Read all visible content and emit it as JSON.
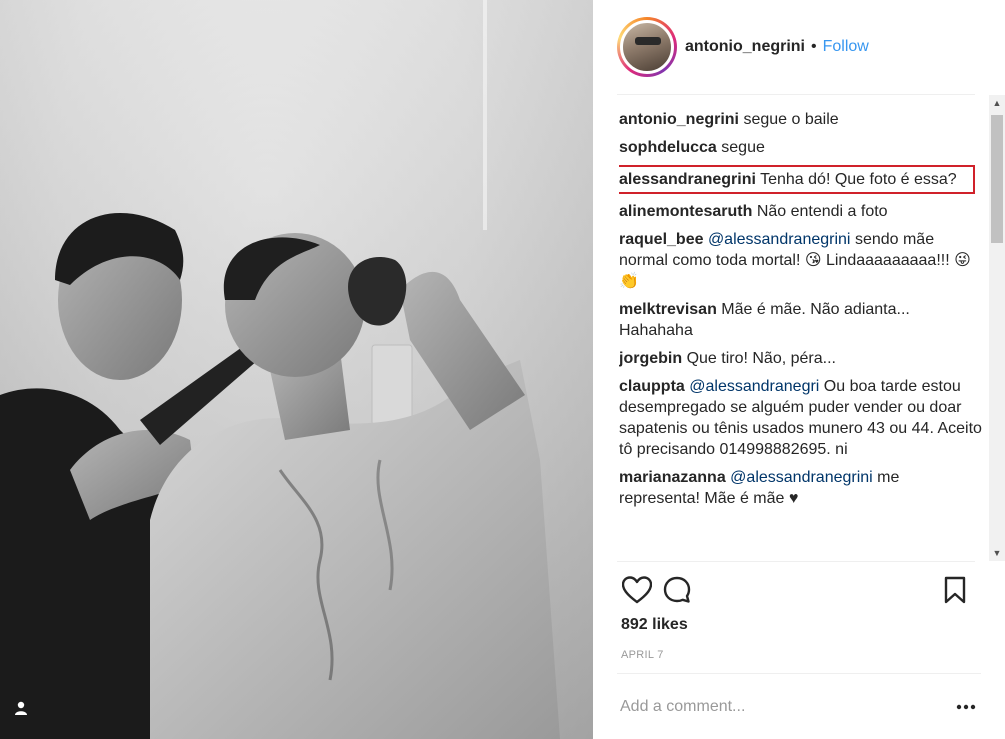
{
  "header": {
    "username": "antonio_negrini",
    "separator": "•",
    "follow_label": "Follow",
    "avatar_icon": "profile-avatar"
  },
  "comments": [
    {
      "user": "antonio_negrini",
      "mention": "",
      "text": "segue o baile"
    },
    {
      "user": "sophdelucca",
      "mention": "",
      "text": "segue"
    },
    {
      "user": "alessandranegrini",
      "mention": "",
      "text": "Tenha dó! Que foto é essa?",
      "highlighted": true
    },
    {
      "user": "alinemontesaruth",
      "mention": "",
      "text": "Não entendi a foto"
    },
    {
      "user": "raquel_bee",
      "mention": "@alessandranegrini",
      "text": "sendo mãe normal como toda mortal! 😘 Lindaaaaaaaaa!!! 😜👏"
    },
    {
      "user": "melktrevisan",
      "mention": "",
      "text": "Mãe é mãe. Não adianta... Hahahaha"
    },
    {
      "user": "jorgebin",
      "mention": "",
      "text": "Que tiro! Não, péra..."
    },
    {
      "user": "clauppta",
      "mention": "@alessandranegri",
      "text": "Ou boa tarde estou desempregado se alguém puder vender ou doar sapatenis ou tênis usados munero 43 ou 44. Aceito tô precisando 014998882695. ni"
    },
    {
      "user": "marianazanna",
      "mention": "@alessandranegrini",
      "text": "me representa! Mãe é mãe ♥"
    }
  ],
  "actions": {
    "like_icon": "heart-icon",
    "comment_icon": "comment-bubble-icon",
    "save_icon": "bookmark-icon"
  },
  "likes": "892 likes",
  "date": "APRIL 7",
  "add_comment": {
    "placeholder": "Add a comment...",
    "more_icon": "more-options-icon"
  },
  "photo": {
    "user_tag_icon": "person-icon"
  },
  "colors": {
    "link_blue": "#3897f0",
    "mention_blue": "#003569",
    "highlight_red": "#d0212a",
    "muted_gray": "#999999"
  }
}
